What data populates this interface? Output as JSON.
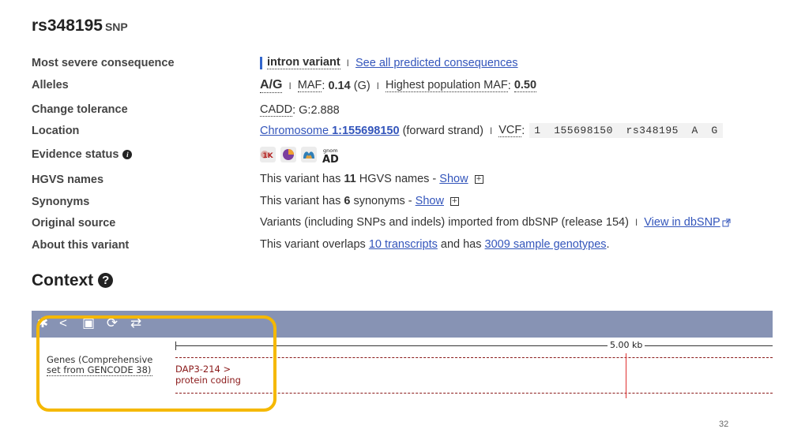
{
  "header": {
    "title": "rs348195",
    "subtitle": "SNP"
  },
  "rows": {
    "most_severe": {
      "label": "Most severe consequence",
      "consequence": "intron variant",
      "sep": "I",
      "link": "See all predicted consequences"
    },
    "alleles": {
      "label": "Alleles",
      "allele": "A/G",
      "sep1": "I",
      "maf_label": "MAF",
      "maf_colon": ": ",
      "maf_value": "0.14",
      "maf_allele": "(G)",
      "sep2": "I",
      "hpmaf_label": "Highest population MAF",
      "hpmaf_colon": ": ",
      "hpmaf_value": "0.50"
    },
    "change_tolerance": {
      "label": "Change tolerance",
      "cadd_label": "CADD",
      "cadd_value": ": G:2.888"
    },
    "location": {
      "label": "Location",
      "chrom_prefix": "Chromosome ",
      "chrom_pos": "1:155698150",
      "strand": " (forward strand)",
      "sep": "I",
      "vcf_label": "VCF",
      "vcf_colon": ":",
      "vcf_value": "1  155698150  rs348195  A  G"
    },
    "evidence": {
      "label": "Evidence status",
      "icons": [
        "1000-genomes-icon",
        "frequency-icon",
        "hapmap-icon",
        "gnomad-icon"
      ],
      "gnomad_small": "gnom",
      "gnomad_big": "AD",
      "onek_text": "1K"
    },
    "hgvs": {
      "label": "HGVS names",
      "prefix": "This variant has ",
      "count": "11",
      "suffix": " HGVS names - ",
      "link": "Show"
    },
    "synonyms": {
      "label": "Synonyms",
      "prefix": "This variant has ",
      "count": "6",
      "suffix": " synonyms - ",
      "link": "Show"
    },
    "original_source": {
      "label": "Original source",
      "text": "Variants (including SNPs and indels) imported from dbSNP (release 154)",
      "sep": "I",
      "link": "View in dbSNP"
    },
    "about": {
      "label": "About this variant",
      "prefix": "This variant overlaps ",
      "link1": "10 transcripts",
      "middle": " and has ",
      "link2": "3009 sample genotypes",
      "suffix": "."
    }
  },
  "context": {
    "title": "Context",
    "track_label_line1": "Genes (Comprehensive",
    "track_label_line2": "set from GENCODE 38)",
    "scale_label": "5.00 kb",
    "gene_name": "DAP3-214 >",
    "gene_type": "protein coding"
  },
  "colors": {
    "link": "#3355bb",
    "toolbar": "#8793b4",
    "highlight": "#f5b800",
    "gene": "#8b1a1a",
    "variant_line": "#e03030"
  },
  "footer": {
    "page_number": "32"
  }
}
